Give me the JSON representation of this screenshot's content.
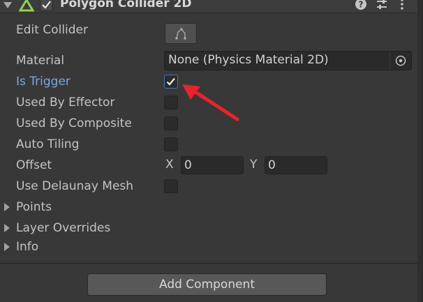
{
  "component": {
    "title": "Polygon Collider 2D",
    "enabled": true
  },
  "rows": {
    "edit_collider": "Edit Collider",
    "material": "Material",
    "material_value": "None (Physics Material 2D)",
    "is_trigger": "Is Trigger",
    "is_trigger_checked": true,
    "used_by_effector": "Used By Effector",
    "used_by_composite": "Used By Composite",
    "auto_tiling": "Auto Tiling",
    "offset": "Offset",
    "offset_x_label": "X",
    "offset_x": "0",
    "offset_y_label": "Y",
    "offset_y": "0",
    "use_delaunay": "Use Delaunay Mesh"
  },
  "foldouts": {
    "points": "Points",
    "layer_overrides": "Layer Overrides",
    "info": "Info"
  },
  "footer": {
    "add_component": "Add Component"
  },
  "colors": {
    "background": "#383838",
    "active_label": "#7ba6e0",
    "arrow": "#e8232b",
    "collider_icon": "#8fd14f"
  }
}
